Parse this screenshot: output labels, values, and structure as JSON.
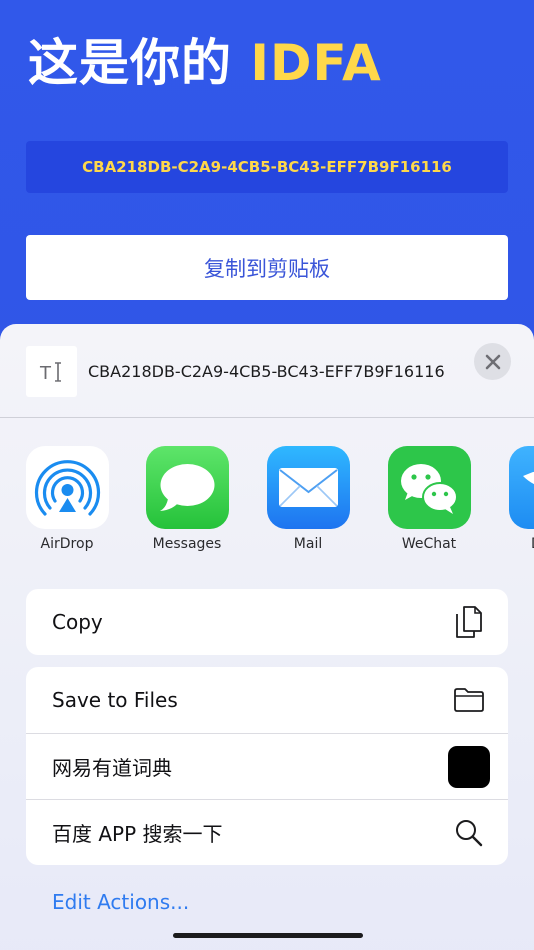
{
  "app": {
    "headline_prefix": "这是你的 ",
    "headline_accent": "IDFA",
    "idfa_value": "CBA218DB-C2A9-4CB5-BC43-EFF7B9F16116",
    "copy_button_label": "复制到剪贴板",
    "colors": {
      "background": "#3158ea",
      "accent": "#ffd84a",
      "button_text": "#3a55d8"
    }
  },
  "share_sheet": {
    "title": "CBA218DB-C2A9-4CB5-BC43-EFF7B9F16116",
    "thumb_icon": "text-icon",
    "apps": [
      {
        "label": "AirDrop",
        "icon": "airdrop-icon"
      },
      {
        "label": "Messages",
        "icon": "messages-icon"
      },
      {
        "label": "Mail",
        "icon": "mail-icon"
      },
      {
        "label": "WeChat",
        "icon": "wechat-icon"
      },
      {
        "label": "Di",
        "icon": "bird-icon"
      }
    ],
    "actions_group1": [
      {
        "label": "Copy",
        "icon": "copy-icon"
      }
    ],
    "actions_group2": [
      {
        "label": "Save to Files",
        "icon": "folder-icon"
      },
      {
        "label": "网易有道词典",
        "icon": "youdao-icon"
      },
      {
        "label": "百度 APP 搜索一下",
        "icon": "search-icon"
      }
    ],
    "edit_actions_label": "Edit Actions..."
  }
}
